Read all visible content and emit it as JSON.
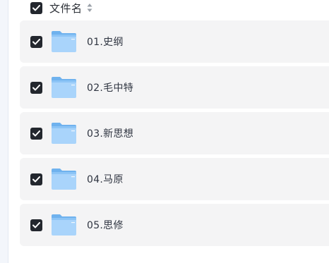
{
  "header": {
    "label": "文件名",
    "sort_icon": "sort-up-down-icon"
  },
  "files": [
    {
      "name": "01.史纲",
      "icon": "folder-icon",
      "checked": true
    },
    {
      "name": "02.毛中特",
      "icon": "folder-icon",
      "checked": true
    },
    {
      "name": "03.新思想",
      "icon": "folder-icon",
      "checked": true
    },
    {
      "name": "04.马原",
      "icon": "folder-icon",
      "checked": true
    },
    {
      "name": "05.思修",
      "icon": "folder-icon",
      "checked": true
    }
  ],
  "colors": {
    "checkbox_bg": "#23272e",
    "row_bg": "#f4f4f5",
    "folder_light": "#a9d4fb",
    "folder_dark": "#6fb2ee"
  }
}
